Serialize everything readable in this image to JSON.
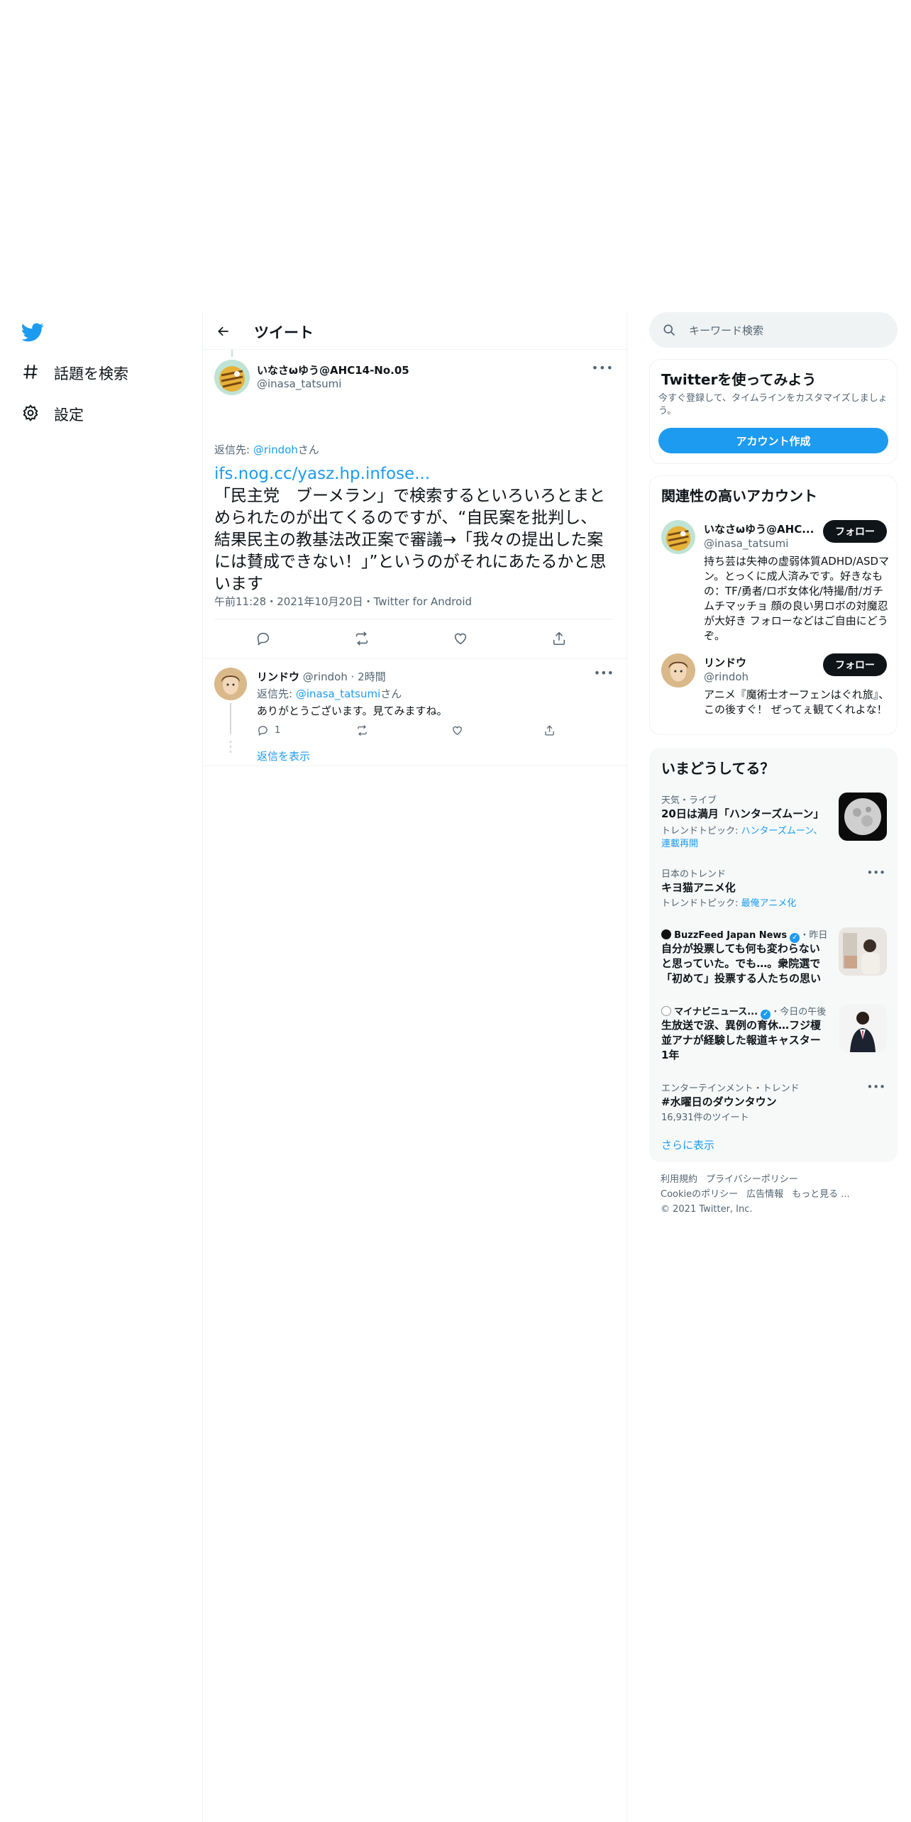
{
  "nav": {
    "items": [
      {
        "label": "話題を検索",
        "icon": "hashtag-icon"
      },
      {
        "label": "設定",
        "icon": "gear-icon"
      }
    ]
  },
  "main": {
    "title": "ツイート",
    "tweet": {
      "author_name": "いなさωゆう@AHC14-No.05",
      "author_handle": "@inasa_tatsumi",
      "reply_prefix": "返信先: ",
      "reply_handle": "@rindoh",
      "reply_suffix": "さん",
      "url": "ifs.nog.cc/yasz.hp.infose...",
      "text": "「民主党　ブーメラン」で検索するといろいろとまとめられたのが出てくるのですが、“自民案を批判し、結果民主の教基法改正案で審議→「我々の提出した案には賛成できない！」”というのがそれにあたるかと思います",
      "meta": "午前11:28・2021年10月20日・Twitter for Android"
    },
    "reply": {
      "name": "リンドウ",
      "handle_time": "@rindoh · 2時間",
      "reply_prefix": "返信先: ",
      "reply_handle": "@inasa_tatsumi",
      "reply_suffix": "さん",
      "text": "ありがとうございます。見てみますね。",
      "reply_count": "1",
      "show_replies": "返信を表示"
    }
  },
  "sidebar": {
    "search_placeholder": "キーワード検索",
    "signup": {
      "title": "Twitterを使ってみよう",
      "desc": "今すぐ登録して、タイムラインをカスタマイズしましょう。",
      "button": "アカウント作成"
    },
    "relevant": {
      "title": "関連性の高いアカウント",
      "follow_label": "フォロー",
      "accounts": [
        {
          "name": "いなさωゆう@AHC...",
          "handle": "@inasa_tatsumi",
          "bio": "持ち芸は失神の虚弱体質ADHD/ASDマン。とっくに成人済みです。好きなもの：TF/勇者/ロボ女体化/特撮/酎/ガチムチマッチョ 顔の良い男ロボの対魔忍が大好き フォローなどはご自由にどうぞ。"
        },
        {
          "name": "リンドウ",
          "handle": "@rindoh",
          "bio": "アニメ『魔術士オーフェンはぐれ旅』、この後すぐ！ ぜってぇ観てくれよな！"
        }
      ]
    },
    "trends": {
      "title": "いまどうしてる？",
      "items": [
        {
          "meta": "天気・ライブ",
          "title": "20日は満月「ハンターズムーン」",
          "sub_prefix": "トレンドトピック: ",
          "sub_link": "ハンターズムーン、連載再開"
        },
        {
          "meta": "日本のトレンド",
          "title": "キヨ猫アニメ化",
          "sub_prefix": "トレンドトピック: ",
          "sub_link": "最俺アニメ化"
        },
        {
          "source": "BuzzFeed Japan News",
          "time": "・昨日",
          "title": "自分が投票しても何も変わらないと思っていた。でも…。衆院選で「初めて」投票する人たちの思い"
        },
        {
          "source": "マイナビニュース...",
          "time": "・今日の午後",
          "title": "生放送で涙、異例の育休…フジ榎並アナが経験した報道キャスター1年"
        },
        {
          "meta": "エンターテインメント・トレンド",
          "title": "#水曜日のダウンタウン",
          "count": "16,931件のツイート"
        }
      ],
      "show_more": "さらに表示"
    },
    "footer": {
      "links": [
        "利用規約",
        "プライバシーポリシー",
        "Cookieのポリシー",
        "広告情報",
        "もっと見る ..."
      ],
      "copyright": "© 2021 Twitter, Inc."
    }
  },
  "colors": {
    "accent": "#1d9bf0",
    "text": "#0f1419",
    "muted": "#536471",
    "border": "#eff3f4"
  }
}
